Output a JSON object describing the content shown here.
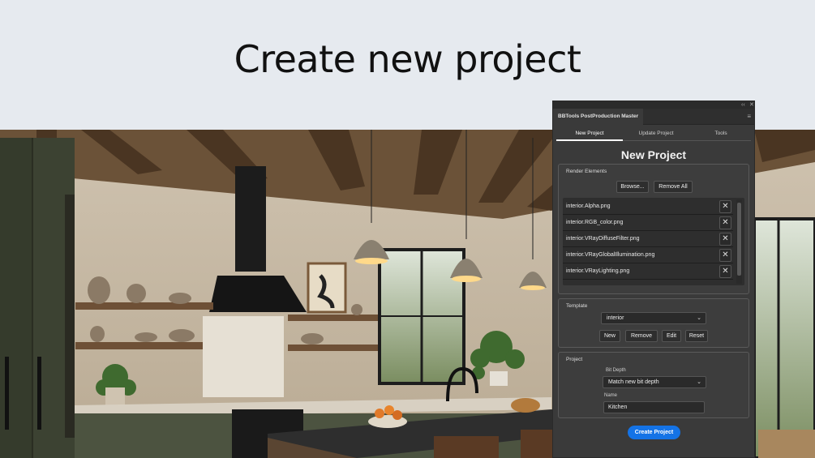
{
  "banner": {
    "title": "Create new project"
  },
  "panel": {
    "window_title": "BBTools PostProduction Master",
    "tabs": [
      {
        "label": "New Project",
        "active": true
      },
      {
        "label": "Update Project",
        "active": false
      },
      {
        "label": "Tools",
        "active": false
      }
    ],
    "heading": "New Project",
    "render_elements": {
      "label": "Render Elements",
      "browse_label": "Browse...",
      "remove_all_label": "Remove All",
      "files": [
        "interior.Alpha.png",
        "interior.RGB_color.png",
        "interior.VRayDiffuseFilter.png",
        "interior.VRayGlobalIllumination.png",
        "interior.VRayLighting.png"
      ],
      "remove_glyph": "✕"
    },
    "template": {
      "label": "Template",
      "selected": "interior",
      "new_label": "New",
      "remove_label": "Remove",
      "edit_label": "Edit",
      "reset_label": "Reset"
    },
    "project": {
      "label": "Project",
      "bit_depth_label": "Bit Depth",
      "bit_depth_value": "Match new bit depth",
      "name_label": "Name",
      "name_value": "Kitchen"
    },
    "create_label": "Create Project",
    "accent_color": "#1473e6"
  }
}
